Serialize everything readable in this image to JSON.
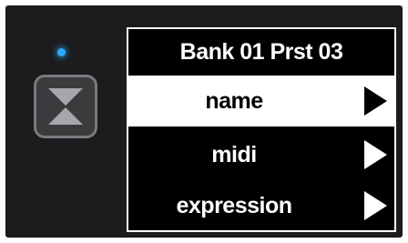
{
  "device": {
    "led_color": "#29a8ff",
    "footswitch_icon": "hourglass-icon"
  },
  "screen": {
    "title": "Bank 01 Prst 03",
    "menu": [
      {
        "label": "name",
        "selected": true,
        "icon": "arrow-right-icon"
      },
      {
        "label": "midi",
        "selected": false,
        "icon": "arrow-right-icon"
      },
      {
        "label": "expression",
        "selected": false,
        "icon": "arrow-right-icon"
      }
    ]
  }
}
